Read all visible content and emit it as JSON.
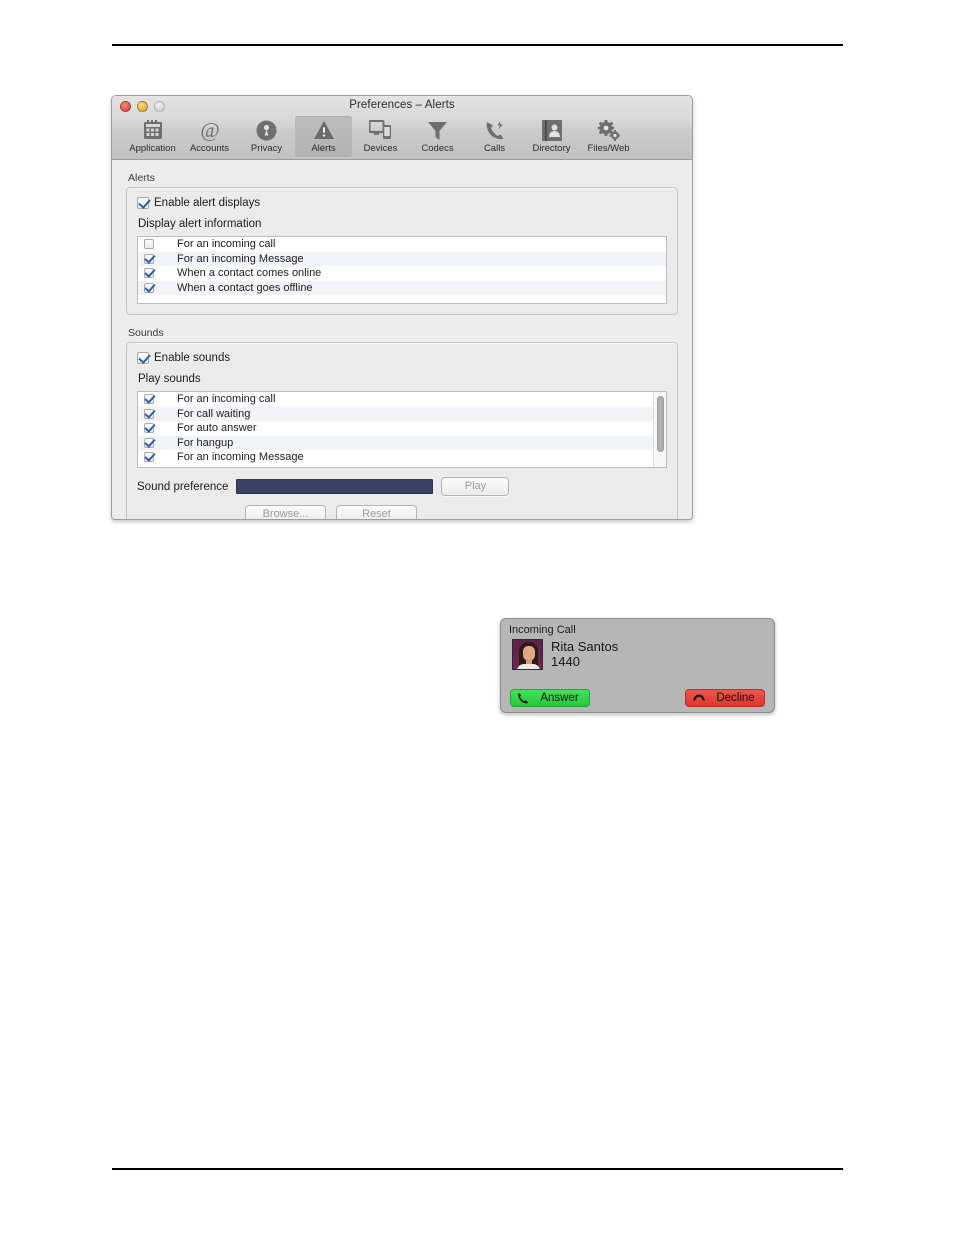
{
  "window": {
    "title": "Preferences – Alerts",
    "traffic_lights": [
      {
        "name": "close-button",
        "color": "#e8655b"
      },
      {
        "name": "minimize-button",
        "color": "#f2c14e"
      },
      {
        "name": "zoom-button",
        "color": "#dedede"
      }
    ],
    "toolbar": {
      "items": [
        {
          "label": "Application",
          "icon": "application-icon",
          "selected": false
        },
        {
          "label": "Accounts",
          "icon": "at-sign-icon",
          "selected": false
        },
        {
          "label": "Privacy",
          "icon": "lock-person-icon",
          "selected": false
        },
        {
          "label": "Alerts",
          "icon": "warning-triangle-icon",
          "selected": true
        },
        {
          "label": "Devices",
          "icon": "monitor-phone-icon",
          "selected": false
        },
        {
          "label": "Codecs",
          "icon": "funnel-icon",
          "selected": false
        },
        {
          "label": "Calls",
          "icon": "phone-handset-icon",
          "selected": false
        },
        {
          "label": "Directory",
          "icon": "contact-card-icon",
          "selected": false
        },
        {
          "label": "Files/Web",
          "icon": "gears-icon",
          "selected": false
        }
      ]
    }
  },
  "alerts_group": {
    "title": "Alerts",
    "enable": {
      "label": "Enable alert displays",
      "checked": true
    },
    "list_label": "Display alert information",
    "rows": [
      {
        "label": "For an incoming call",
        "checked": false
      },
      {
        "label": "For an incoming Message",
        "checked": true
      },
      {
        "label": "When a contact comes online",
        "checked": true
      },
      {
        "label": "When a contact goes offline",
        "checked": true
      }
    ]
  },
  "sounds_group": {
    "title": "Sounds",
    "enable": {
      "label": "Enable sounds",
      "checked": true
    },
    "list_label": "Play sounds",
    "rows": [
      {
        "label": "For an incoming call",
        "checked": true
      },
      {
        "label": "For call waiting",
        "checked": true
      },
      {
        "label": "For auto answer",
        "checked": true
      },
      {
        "label": "For hangup",
        "checked": true
      },
      {
        "label": "For an incoming Message",
        "checked": true
      }
    ],
    "sound_preference": {
      "label": "Sound preference",
      "value": "",
      "field_color": "#3b4265"
    },
    "buttons": {
      "play": "Play",
      "browse": "Browse...",
      "reset": "Reset"
    }
  },
  "incoming_call": {
    "title": "Incoming Call",
    "caller_name": "Rita Santos",
    "caller_number": "1440",
    "answer_label": "Answer",
    "decline_label": "Decline",
    "answer_color": "#24c93c",
    "decline_color": "#e0352c"
  }
}
